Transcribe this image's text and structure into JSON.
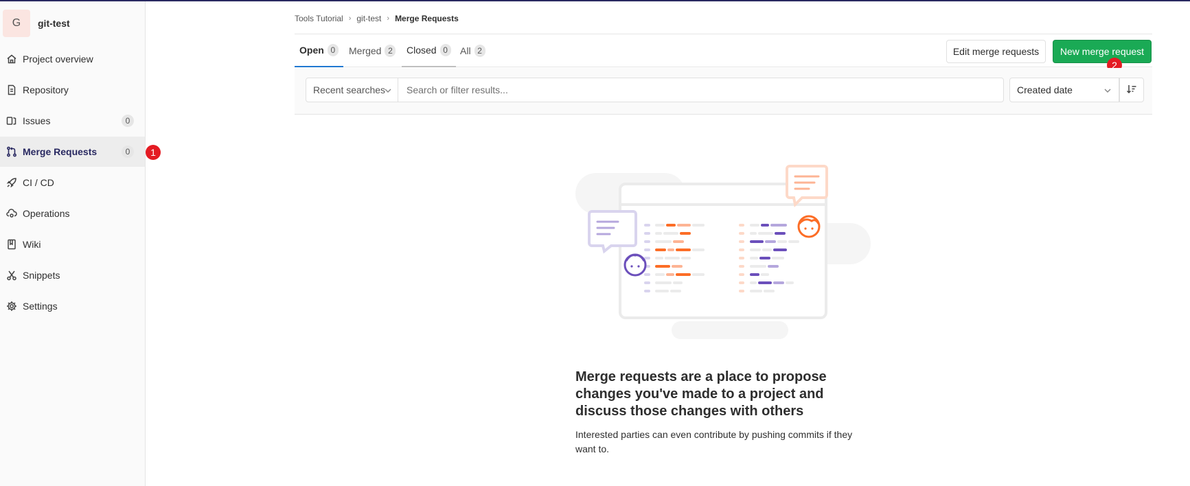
{
  "project": {
    "avatar_letter": "G",
    "name": "git-test"
  },
  "sidebar": {
    "items": [
      {
        "label": "Project overview",
        "icon": "home-icon"
      },
      {
        "label": "Repository",
        "icon": "doc-icon"
      },
      {
        "label": "Issues",
        "icon": "issues-icon",
        "count": "0"
      },
      {
        "label": "Merge Requests",
        "icon": "merge-request-icon",
        "count": "0"
      },
      {
        "label": "CI / CD",
        "icon": "rocket-icon"
      },
      {
        "label": "Operations",
        "icon": "cloud-gear-icon"
      },
      {
        "label": "Wiki",
        "icon": "book-icon"
      },
      {
        "label": "Snippets",
        "icon": "scissors-icon"
      },
      {
        "label": "Settings",
        "icon": "gear-icon"
      }
    ]
  },
  "markers": {
    "one": "1",
    "two": "2"
  },
  "breadcrumb": {
    "group": "Tools Tutorial",
    "project": "git-test",
    "current": "Merge Requests"
  },
  "tabs": [
    {
      "label": "Open",
      "count": "0"
    },
    {
      "label": "Merged",
      "count": "2"
    },
    {
      "label": "Closed",
      "count": "0"
    },
    {
      "label": "All",
      "count": "2"
    }
  ],
  "buttons": {
    "edit": "Edit merge requests",
    "new": "New merge request"
  },
  "filter": {
    "recent_searches": "Recent searches",
    "search_placeholder": "Search or filter results...",
    "sort_by": "Created date"
  },
  "empty_state": {
    "title": "Merge requests are a place to propose changes you've made to a project and discuss those changes with others",
    "description": "Interested parties can even contribute by pushing commits if they want to."
  },
  "colors": {
    "accent_green": "#1aaa55",
    "marker_red": "#e41b23",
    "active_tab_underline": "#1f78d1",
    "illustration_orange": "#fc6d26",
    "illustration_purple": "#6b4fbb"
  }
}
